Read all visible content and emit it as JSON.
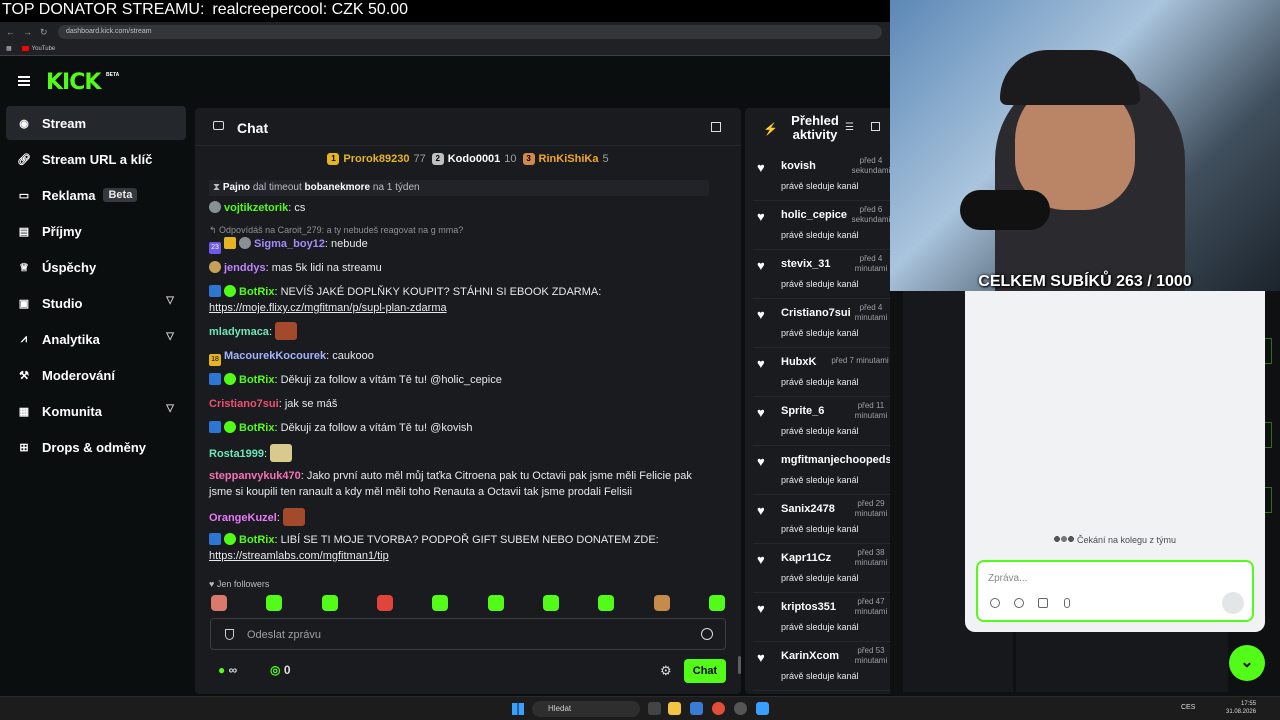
{
  "overlay": {
    "label": "TOP DONATOR STREAMU:",
    "donor": "realcreepercool: CZK 50.00"
  },
  "browser": {
    "url": "dashboard.kick.com/stream",
    "bookmark": "YouTube"
  },
  "header": {
    "logo": "KICK",
    "beta": "BETA"
  },
  "sidebar": {
    "items": [
      {
        "label": "Stream",
        "icon": "stream-icon"
      },
      {
        "label": "Stream URL a klíč",
        "icon": "link-icon"
      },
      {
        "label": "Reklama",
        "icon": "ad-icon",
        "badge": "Beta"
      },
      {
        "label": "Příjmy",
        "icon": "wallet-icon"
      },
      {
        "label": "Úspěchy",
        "icon": "trophy-icon"
      },
      {
        "label": "Studio",
        "icon": "studio-icon"
      },
      {
        "label": "Analytika",
        "icon": "chart-icon"
      },
      {
        "label": "Moderování",
        "icon": "wrench-icon"
      },
      {
        "label": "Komunita",
        "icon": "community-icon"
      },
      {
        "label": "Drops & odměny",
        "icon": "gift-icon"
      }
    ]
  },
  "chat": {
    "title": "Chat",
    "leaderboard": [
      {
        "rank": "1",
        "name": "Prorok89230",
        "count": "77",
        "color": "#e6b422"
      },
      {
        "rank": "2",
        "name": "Kodo0001",
        "count": "10",
        "color": "#c0c0c0"
      },
      {
        "rank": "3",
        "name": "RinKiShiKa",
        "count": "5",
        "color": "#d08a4e"
      }
    ],
    "messages": {
      "m1": {
        "user": "Pajno",
        "mid": "dal timeout",
        "target": "bobanekmore",
        "tail": "na 1 týden"
      },
      "m2": {
        "user": "vojtikzetorik",
        "text": "cs",
        "color": "#53fc18"
      },
      "m3": {
        "text": "Odpovídáš na Caroit_279: a ty nebudeš reagovat na g mma?"
      },
      "m4": {
        "badge": "23",
        "user": "Sigma_boy12",
        "text": "nebude",
        "color": "#a78bfa"
      },
      "m5": {
        "user": "jenddys",
        "text": "mas 5k lidi na streamu",
        "color": "#c084fc"
      },
      "m6": {
        "user": "BotRix",
        "text": "NEVÍŠ JAKÉ DOPLŇKY KOUPIT? STÁHNI SI EBOOK ZDARMA:",
        "link": "https://moje.flixy.cz/mgfitman/p/supl-plan-zdarma",
        "color": "#53fc18"
      },
      "m7": {
        "user": "mladymaca",
        "color": "#6ee7b7"
      },
      "m8": {
        "badge": "18",
        "user": "MacourekKocourek",
        "text": "caukooo",
        "color": "#a5b4fc"
      },
      "m9": {
        "user": "BotRix",
        "text": "Děkuji za follow a vítám Tě tu! @holic_cepice",
        "color": "#53fc18"
      },
      "m10": {
        "user": "Cristiano7sui",
        "text": "jak se máš",
        "color": "#f0506e"
      },
      "m11": {
        "user": "BotRix",
        "text": "Děkuji za follow a vítám Tě tu! @kovish",
        "color": "#53fc18"
      },
      "m12": {
        "user": "Rosta1999",
        "color": "#6ee7b7"
      },
      "m13": {
        "user": "steppanvykuk470",
        "line1": "Jako první auto měl můj taťka Citroena pak tu Octavii pak jsme měli Felicie pak",
        "line2": "jsme si koupili ten ranault a kdy měl měli toho Renauta a Octavii tak jsme prodali Felisii",
        "color": "#f472b6"
      },
      "m14": {
        "user": "OrangeKuzel",
        "color": "#e879f9"
      },
      "m15": {
        "user": "BotRix",
        "text": "LIBÍ SE TI MOJE TVORBA? PODPOŘ GIFT SUBEM NEBO DONATEM ZDE:",
        "link": "https://streamlabs.com/mgfitman1/tip",
        "color": "#53fc18"
      }
    },
    "followers_only": "Jen followers",
    "input_placeholder": "Odeslat zprávu",
    "viewers_symbol": "∞",
    "points": "0",
    "send_label": "Chat"
  },
  "activity": {
    "title": "Přehled aktivity",
    "status": "právě sleduje kanál",
    "items": [
      {
        "name": "kovish",
        "time": "před 4 sekundami"
      },
      {
        "name": "holic_cepice",
        "time": "před 6 sekundami"
      },
      {
        "name": "stevix_31",
        "time": "před 4 minutami"
      },
      {
        "name": "Cristiano7sui",
        "time": "před 4 minutami"
      },
      {
        "name": "HubxK",
        "time": "před 7 minutami"
      },
      {
        "name": "Sprite_6",
        "time": "před 11 minutami"
      },
      {
        "name": "mgfitmanjechoopeds",
        "time": ""
      },
      {
        "name": "Sanix2478",
        "time": "před 29 minutami"
      },
      {
        "name": "Kapr11Cz",
        "time": "před 38 minutami"
      },
      {
        "name": "kriptos351",
        "time": "před 47 minutami"
      },
      {
        "name": "KarinXcom",
        "time": "před 53 minutami"
      }
    ]
  },
  "webcam": {
    "subs_label": "CELKEM SUBÍKŮ 263 / 1000"
  },
  "team_chat": {
    "waiting": "Čekání na kolegu z týmu",
    "placeholder": "Zpráva..."
  },
  "taskbar": {
    "search": "Hledat",
    "lang": "CES",
    "time": "17:55",
    "date": "31.08.2026"
  },
  "colors": {
    "accent": "#53fc18",
    "panel": "#191b1f",
    "background": "#0b0e0f"
  }
}
